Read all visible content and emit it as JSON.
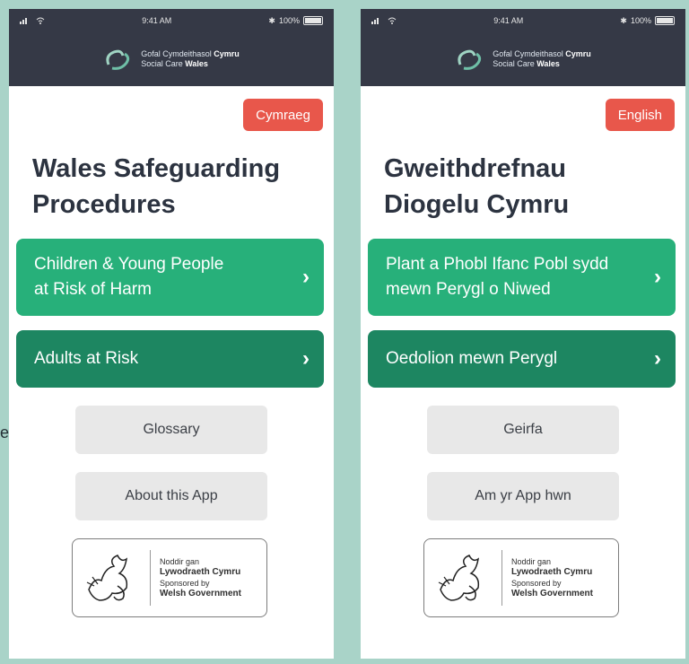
{
  "status": {
    "time": "9:41 AM",
    "battery": "100%"
  },
  "brand": {
    "line1": "Gofal Cymdeithasol",
    "line1_bold": "Cymru",
    "line2": "Social Care",
    "line2_bold": "Wales"
  },
  "edge_label": "e",
  "screens": [
    {
      "lang_button": "Cymraeg",
      "title_line1": "Wales Safeguarding",
      "title_line2": "Procedures",
      "card1_line1": "Children & Young People",
      "card1_line2": "at Risk of Harm",
      "card2": "Adults at Risk",
      "glossary": "Glossary",
      "about": "About this App"
    },
    {
      "lang_button": "English",
      "title_line1": "Gweithdrefnau",
      "title_line2": "Diogelu Cymru",
      "card1_line1": "Plant a Phobl Ifanc Pobl sydd",
      "card1_line2": "mewn Perygl o Niwed",
      "card2": "Oedolion mewn Perygl",
      "glossary": "Geirfa",
      "about": "Am yr App hwn"
    }
  ],
  "sponsor": {
    "line1": "Noddir gan",
    "line2": "Lywodraeth Cymru",
    "line3": "Sponsored by",
    "line4": "Welsh Government"
  },
  "colors": {
    "header": "#353946",
    "lang_button": "#e8574b",
    "card_primary": "#27b07a",
    "card_secondary": "#1d8661",
    "background": "#a9d3c8"
  },
  "icons": {
    "chevron": "›"
  }
}
